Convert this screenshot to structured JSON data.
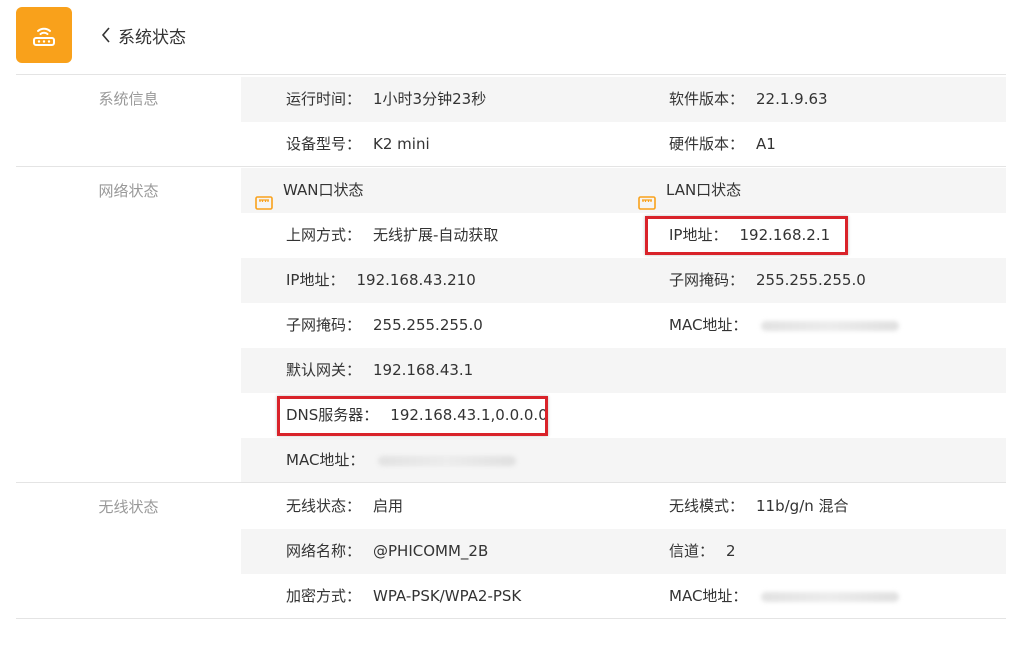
{
  "header": {
    "title": "系统状态",
    "logo_icon": "router-wifi-icon",
    "accent": "#f9a11b"
  },
  "system": {
    "label": "系统信息",
    "runtime_label": "运行时间：",
    "runtime_value": "1小时3分钟23秒",
    "software_label": "软件版本：",
    "software_value": "22.1.9.63",
    "model_label": "设备型号：",
    "model_value": "K2 mini",
    "hardware_label": "硬件版本：",
    "hardware_value": "A1"
  },
  "network": {
    "label": "网络状态",
    "wan_title": "WAN口状态",
    "lan_title": "LAN口状态",
    "wan": {
      "mode_label": "上网方式：",
      "mode_value": "无线扩展-自动获取",
      "ip_label": "IP地址：",
      "ip_value": "192.168.43.210",
      "mask_label": "子网掩码：",
      "mask_value": "255.255.255.0",
      "gateway_label": "默认网关：",
      "gateway_value": "192.168.43.1",
      "dns_label": "DNS服务器：",
      "dns_value": "192.168.43.1,0.0.0.0",
      "mac_label": "MAC地址："
    },
    "lan": {
      "ip_label": "IP地址：",
      "ip_value": "192.168.2.1",
      "mask_label": "子网掩码：",
      "mask_value": "255.255.255.0",
      "mac_label": "MAC地址："
    }
  },
  "wireless": {
    "label": "无线状态",
    "status_label": "无线状态：",
    "status_value": "启用",
    "mode_label": "无线模式：",
    "mode_value": "11b/g/n 混合",
    "ssid_label": "网络名称：",
    "ssid_value": "@PHICOMM_2B",
    "channel_label": "信道：",
    "channel_value": "2",
    "encrypt_label": "加密方式：",
    "encrypt_value": "WPA-PSK/WPA2-PSK",
    "mac_label": "MAC地址："
  },
  "colors": {
    "highlight": "#d9232a",
    "row_shade": "#f5f5f5",
    "section_label": "#999999"
  }
}
